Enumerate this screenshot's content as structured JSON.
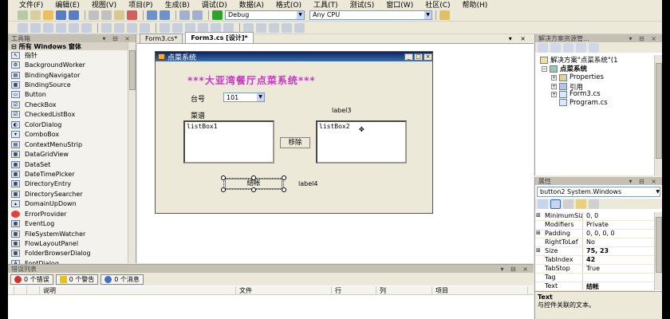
{
  "menu": [
    "文件(F)",
    "编辑(E)",
    "视图(V)",
    "项目(P)",
    "生成(B)",
    "调试(D)",
    "数据(A)",
    "格式(O)",
    "工具(T)",
    "测试(S)",
    "窗口(W)",
    "社区(C)",
    "帮助(H)"
  ],
  "toolbar": {
    "config": "Debug",
    "platform": "Any CPU"
  },
  "toolbox": {
    "title": "工具箱",
    "section": "所有 Windows 窗体",
    "items": [
      "指针",
      "BackgroundWorker",
      "BindingNavigator",
      "BindingSource",
      "Button",
      "CheckBox",
      "CheckedListBox",
      "ColorDialog",
      "ComboBox",
      "ContextMenuStrip",
      "DataGridView",
      "DataSet",
      "DateTimePicker",
      "DirectoryEntry",
      "DirectorySearcher",
      "DomainUpDown",
      "ErrorProvider",
      "EventLog",
      "FileSystemWatcher",
      "FlowLayoutPanel",
      "FolderBrowserDialog",
      "FontDialog"
    ]
  },
  "doc_tabs": [
    "Form3.cs*",
    "Form3.cs [设计]*"
  ],
  "form": {
    "title": "点菜系统",
    "banner": "***大亚湾餐厅点菜系统***",
    "table_label": "台号",
    "table_value": "101",
    "menu_label": "菜谱",
    "label3": "label3",
    "listbox1": "listBox1",
    "listbox2": "listBox2",
    "remove_button": "移除",
    "checkout_button": "结帐",
    "label4": "label4"
  },
  "solution": {
    "title": "解决方案资源管...",
    "root": "解决方案\"点菜系统\"(1",
    "project": "点菜系统",
    "items": [
      "Properties",
      "引用",
      "Form3.cs",
      "Program.cs"
    ]
  },
  "properties": {
    "title": "属性",
    "object": "button2 System.Windows",
    "rows": [
      {
        "name": "MinimumSiz",
        "value": "0, 0"
      },
      {
        "name": "Modifiers",
        "value": "Private"
      },
      {
        "name": "Padding",
        "value": "0, 0, 0, 0"
      },
      {
        "name": "RightToLef",
        "value": "No"
      },
      {
        "name": "Size",
        "value": "75, 23"
      },
      {
        "name": "TabIndex",
        "value": "42"
      },
      {
        "name": "TabStop",
        "value": "True"
      },
      {
        "name": "Tag",
        "value": ""
      },
      {
        "name": "Text",
        "value": "结帐"
      }
    ],
    "desc_title": "Text",
    "desc_text": "与控件关联的文本。"
  },
  "error_list": {
    "title": "错误列表",
    "tabs": [
      "0 个错误",
      "0 个警告",
      "0 个消息"
    ],
    "columns": [
      "说明",
      "文件",
      "行",
      "列",
      "项目"
    ]
  },
  "colors": {
    "banner": "#cc33cc",
    "titlebar": "#0a246a"
  }
}
